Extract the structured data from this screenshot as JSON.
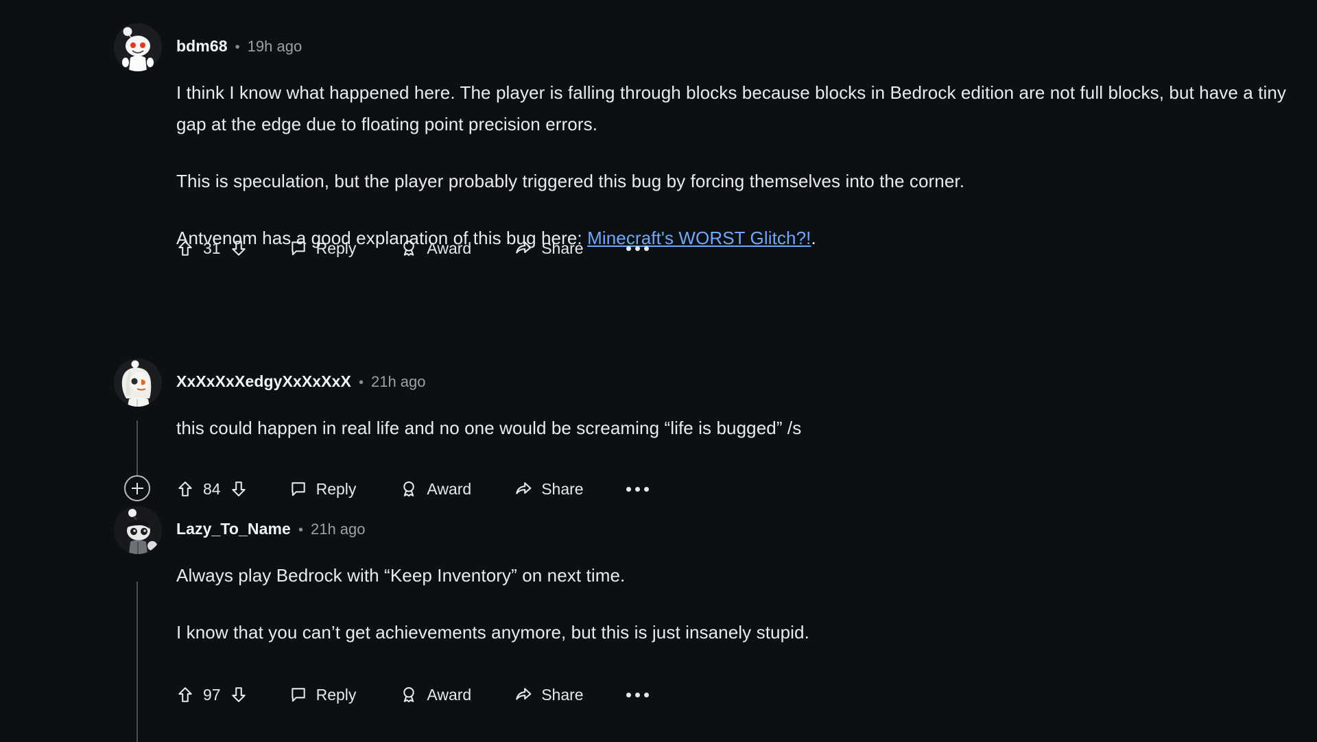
{
  "theme": {
    "background": "#0d1013",
    "text": "#e9ecef",
    "muted": "#9ba1a6",
    "link": "#6fa8ff",
    "thread_line": "#4a5155"
  },
  "actions_labels": {
    "reply": "Reply",
    "award": "Award",
    "share": "Share",
    "more": "more-options",
    "upvote": "upvote",
    "downvote": "downvote",
    "expand": "expand-thread"
  },
  "comments": [
    {
      "id": "comment-1",
      "username": "bdm68",
      "separator": "•",
      "timestamp": "19h ago",
      "avatar": "default-snoo-avatar",
      "score": "31",
      "has_expand_button": false,
      "has_thread_line": false,
      "paragraphs": [
        {
          "type": "text",
          "text": "I think I know what happened here. The player is falling through blocks because blocks in Bedrock edition are not full blocks, but have a tiny gap at the edge due to floating point precision errors."
        },
        {
          "type": "text",
          "text": "This is speculation, but the player probably triggered this bug by forcing themselves into the corner."
        },
        {
          "type": "rich",
          "before": "Antvenom has a good explanation of this bug here: ",
          "link_text": "Minecraft's WORST Glitch?!",
          "after": "."
        }
      ]
    },
    {
      "id": "comment-2",
      "username": "XxXxXxXedgyXxXxXxX",
      "separator": "•",
      "timestamp": "21h ago",
      "avatar": "white-haired-snoo-avatar",
      "score": "84",
      "has_expand_button": true,
      "has_thread_line": true,
      "paragraphs": [
        {
          "type": "text",
          "text": "this could happen in real life and no one would be screaming “life is bugged” /s"
        }
      ]
    },
    {
      "id": "comment-3",
      "username": "Lazy_To_Name",
      "separator": "•",
      "timestamp": "21h ago",
      "avatar": "dark-snoo-avatar",
      "score": "97",
      "has_expand_button": false,
      "has_thread_line": true,
      "paragraphs": [
        {
          "type": "text",
          "text": "Always play Bedrock with “Keep Inventory” on next time."
        },
        {
          "type": "text",
          "text": "I know that you can’t get achievements anymore, but this is just insanely stupid."
        }
      ]
    }
  ]
}
